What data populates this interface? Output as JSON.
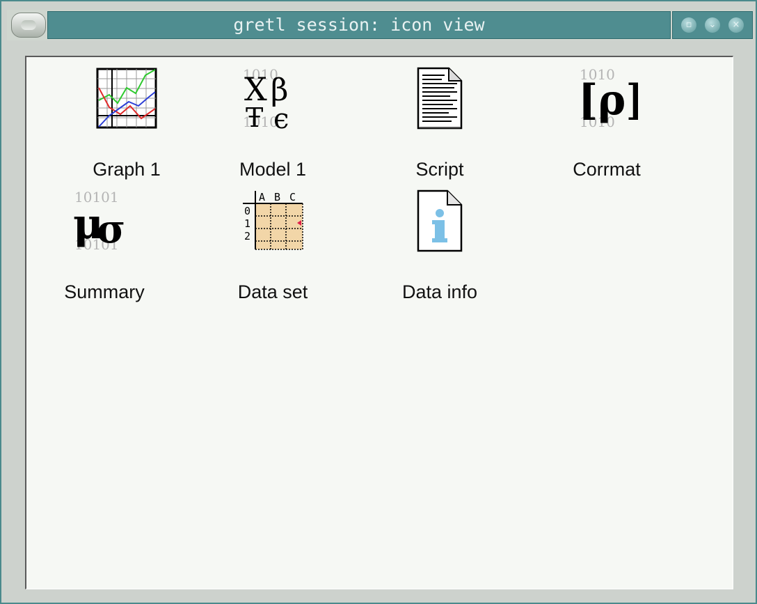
{
  "window": {
    "title": "gretl session: icon view",
    "buttons": [
      {
        "name": "minimize",
        "glyph": "▫"
      },
      {
        "name": "maximize",
        "glyph": "⌄"
      },
      {
        "name": "close",
        "glyph": "×"
      }
    ]
  },
  "icons": [
    {
      "label": "Graph 1",
      "icon": "graph-icon"
    },
    {
      "label": "Model 1",
      "icon": "model-icon"
    },
    {
      "label": "Script",
      "icon": "script-icon"
    },
    {
      "label": "Corrmat",
      "icon": "corrmat-icon"
    },
    {
      "label": "Summary",
      "icon": "summary-icon"
    },
    {
      "label": "Data set",
      "icon": "dataset-icon"
    },
    {
      "label": "Data info",
      "icon": "datainfo-icon"
    }
  ],
  "colors": {
    "titlebar": "#4f8d90",
    "content_bg": "#f6f8f4",
    "window_frame": "#cdd2cd"
  }
}
